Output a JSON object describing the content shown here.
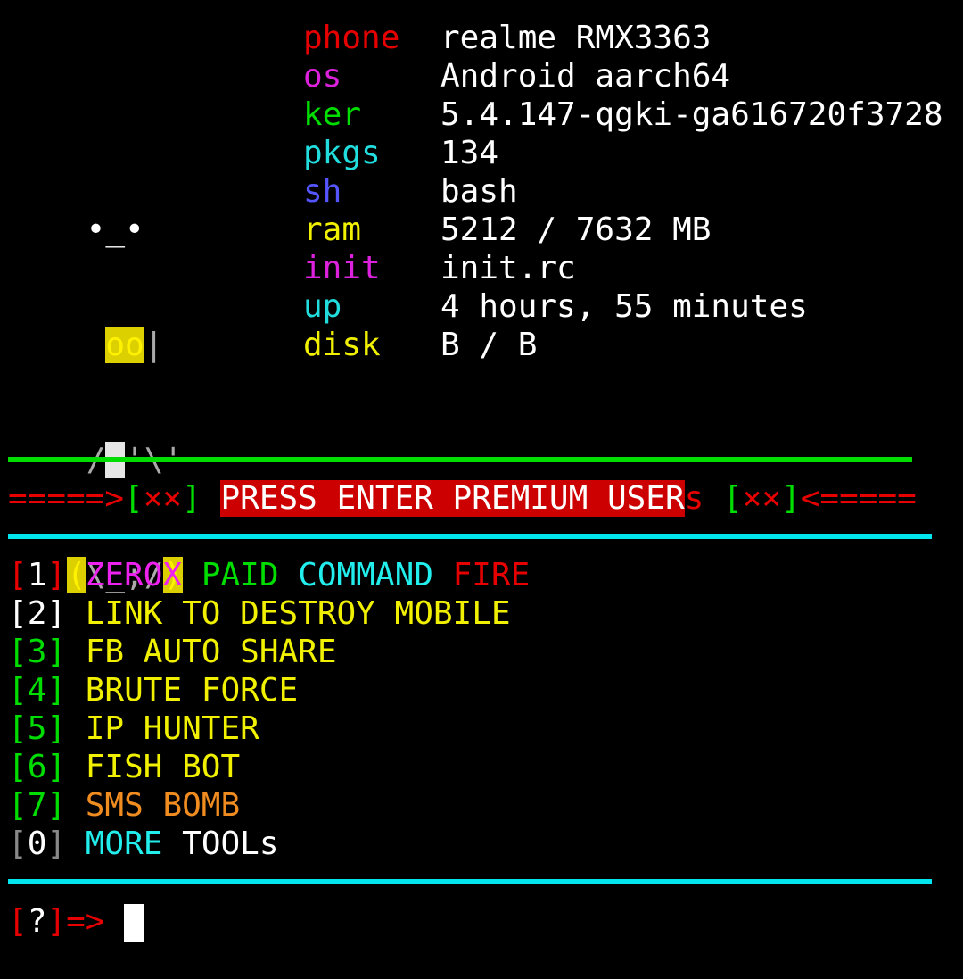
{
  "logo": {
    "line1": " •_•",
    "line2_a": "oo",
    "line2_b": "|",
    "line3_a": "/",
    "line3_b": "'\\'",
    "line4_a": "(",
    "line4_b": "\\_;/",
    "line4_c": ")"
  },
  "info": [
    {
      "key": "phone",
      "value": "realme RMX3363",
      "color": "#e60000"
    },
    {
      "key": "os",
      "value": "Android aarch64",
      "color": "#dd22dd"
    },
    {
      "key": "ker",
      "value": "5.4.147-qgki-ga616720f3728",
      "color": "#00dd00"
    },
    {
      "key": "pkgs",
      "value": "134",
      "color": "#22dddd"
    },
    {
      "key": "sh",
      "value": "bash",
      "color": "#5555ff"
    },
    {
      "key": "ram",
      "value": "5212 / 7632 MB",
      "color": "#f0f000"
    },
    {
      "key": "init",
      "value": "init.rc",
      "color": "#dd22dd"
    },
    {
      "key": "up",
      "value": "4 hours, 55 minutes",
      "color": "#22dddd"
    },
    {
      "key": "disk",
      "value": "B / B",
      "color": "#f0f000"
    }
  ],
  "banner": {
    "left_arrow": "=====>",
    "left_bracket_open": "[",
    "left_marks": "××",
    "left_bracket_close": "]",
    "highlight": "PRESS ENTER PREMIUM USER",
    "tail": "s",
    "right_bracket_open": "[",
    "right_marks": "××",
    "right_bracket_close": "]",
    "right_arrow": "<====="
  },
  "colors": {
    "green_rule": "#00dd00",
    "cyan_rule": "#00e5ee",
    "red": "#e60000",
    "yellow": "#f0f000",
    "orange": "#f08c20",
    "magenta": "#ee22ee",
    "cyan": "#22eeee"
  },
  "menu": [
    {
      "num": "1",
      "parts": [
        "ZEROX",
        "PAID",
        "COMMAND",
        "FIRE"
      ]
    },
    {
      "num": "2",
      "label": "LINK TO DESTROY MOBILE"
    },
    {
      "num": "3",
      "label": "FB AUTO SHARE"
    },
    {
      "num": "4",
      "label": "BRUTE FORCE"
    },
    {
      "num": "5",
      "label": "IP HUNTER"
    },
    {
      "num": "6",
      "label": "FISH BOT"
    },
    {
      "num": "7",
      "label": "SMS BOMB"
    },
    {
      "num": "0",
      "parts": [
        "MORE",
        "TOOLs"
      ]
    }
  ],
  "prompt": {
    "open": "[",
    "q": "?",
    "close": "]",
    "arrow": "=>"
  }
}
